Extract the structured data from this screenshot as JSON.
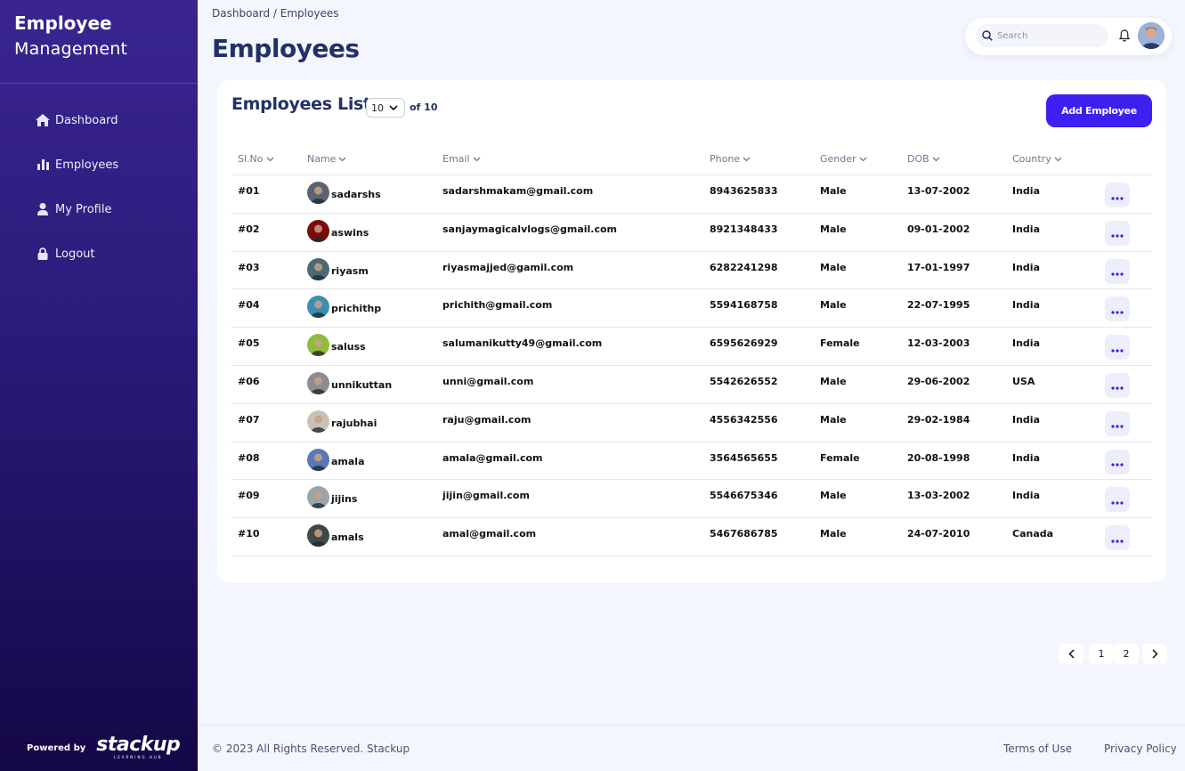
{
  "sidebar": {
    "brand_line1": "Employee",
    "brand_line2": "Management",
    "nav": [
      {
        "label": "Dashboard",
        "icon": "home-icon"
      },
      {
        "label": "Employees",
        "icon": "bar-chart-icon"
      },
      {
        "label": "My Profile",
        "icon": "user-icon"
      },
      {
        "label": "Logout",
        "icon": "lock-icon"
      }
    ],
    "powered_by": "Powered by",
    "logo_word": "stackup",
    "logo_sub": "LEARNING HUB"
  },
  "header": {
    "breadcrumb": "Dashboard / Employees",
    "title": "Employees",
    "search_placeholder": "Search"
  },
  "card": {
    "title": "Employees List",
    "page_size": "10",
    "of_total": "of 10",
    "add_button": "Add Employee"
  },
  "table": {
    "headers": [
      "Sl.No",
      "Name",
      "Email",
      "Phone",
      "Gender",
      "DOB",
      "Country"
    ],
    "rows": [
      {
        "sl": "#01",
        "name": "sadarshs",
        "email": "sadarshmakam@gmail.com",
        "phone": "8943625833",
        "gender": "Male",
        "dob": "13-07-2002",
        "country": "India",
        "avatar_color": "#5b6470"
      },
      {
        "sl": "#02",
        "name": "aswins",
        "email": "sanjaymagicalvlogs@gmail.com",
        "phone": "8921348433",
        "gender": "Male",
        "dob": "09-01-2002",
        "country": "India",
        "avatar_color": "#7a0c0c"
      },
      {
        "sl": "#03",
        "name": "riyasm",
        "email": "riyasmajjed@gamil.com",
        "phone": "6282241298",
        "gender": "Male",
        "dob": "17-01-1997",
        "country": "India",
        "avatar_color": "#4a6a72"
      },
      {
        "sl": "#04",
        "name": "prichithp",
        "email": "prichith@gmail.com",
        "phone": "5594168758",
        "gender": "Male",
        "dob": "22-07-1995",
        "country": "India",
        "avatar_color": "#3a8fb0"
      },
      {
        "sl": "#05",
        "name": "saluss",
        "email": "salumanikutty49@gmail.com",
        "phone": "6595626929",
        "gender": "Female",
        "dob": "12-03-2003",
        "country": "India",
        "avatar_color": "#8dbb3c"
      },
      {
        "sl": "#06",
        "name": "unnikuttan",
        "email": "unni@gmail.com",
        "phone": "5542626552",
        "gender": "Male",
        "dob": "29-06-2002",
        "country": "USA",
        "avatar_color": "#8c8c92"
      },
      {
        "sl": "#07",
        "name": "rajubhai",
        "email": "raju@gmail.com",
        "phone": "4556342556",
        "gender": "Male",
        "dob": "29-02-1984",
        "country": "India",
        "avatar_color": "#c8c2b4"
      },
      {
        "sl": "#08",
        "name": "amala",
        "email": "amala@gmail.com",
        "phone": "3564565655",
        "gender": "Female",
        "dob": "20-08-1998",
        "country": "India",
        "avatar_color": "#5a78b8"
      },
      {
        "sl": "#09",
        "name": "jijins",
        "email": "jijin@gmail.com",
        "phone": "5546675346",
        "gender": "Male",
        "dob": "13-03-2002",
        "country": "India",
        "avatar_color": "#9aa3a8"
      },
      {
        "sl": "#10",
        "name": "amals",
        "email": "amal@gmail.com",
        "phone": "5467686785",
        "gender": "Male",
        "dob": "24-07-2010",
        "country": "Canada",
        "avatar_color": "#3d4a48"
      }
    ]
  },
  "pagination": {
    "pages": [
      "1",
      "2"
    ]
  },
  "footer": {
    "copyright": "© 2023 All Rights Reserved. Stackup",
    "terms": "Terms of Use",
    "privacy": "Privacy Policy"
  },
  "colors": {
    "accent": "#3d1ff0",
    "title": "#22306a",
    "sidebar_top": "#3a2590",
    "sidebar_bottom": "#140747"
  }
}
